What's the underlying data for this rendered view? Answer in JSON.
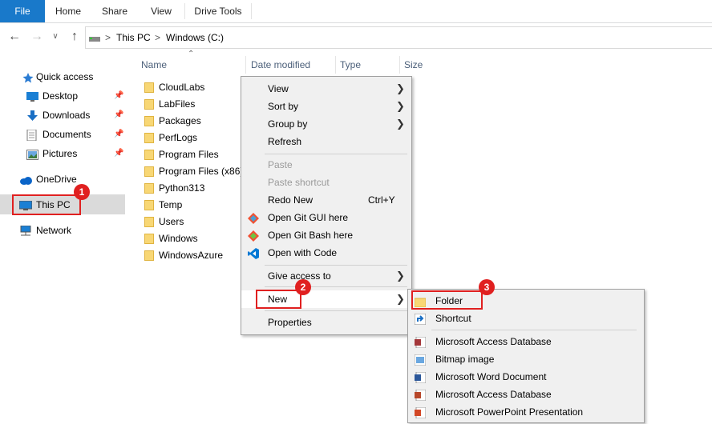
{
  "ribbon": {
    "tabs": [
      "File",
      "Home",
      "Share",
      "View",
      "Drive Tools"
    ]
  },
  "address": {
    "crumbs": [
      "This PC",
      "Windows (C:)"
    ],
    "separator": ">"
  },
  "nav": {
    "quick_access": "Quick access",
    "items": [
      "Desktop",
      "Downloads",
      "Documents",
      "Pictures"
    ],
    "onedrive": "OneDrive",
    "thispc": "This PC",
    "network": "Network"
  },
  "columns": [
    "Name",
    "Date modified",
    "Type",
    "Size"
  ],
  "files": [
    "CloudLabs",
    "LabFiles",
    "Packages",
    "PerfLogs",
    "Program Files",
    "Program Files (x86)",
    "Python313",
    "Temp",
    "Users",
    "Windows",
    "WindowsAzure"
  ],
  "context_menu": {
    "view": "View",
    "sort_by": "Sort by",
    "group_by": "Group by",
    "refresh": "Refresh",
    "paste": "Paste",
    "paste_shortcut": "Paste shortcut",
    "redo": "Redo New",
    "redo_shortcut": "Ctrl+Y",
    "git_gui": "Open Git GUI here",
    "git_bash": "Open Git Bash here",
    "open_code": "Open with Code",
    "give_access": "Give access to",
    "new": "New",
    "properties": "Properties"
  },
  "submenu": {
    "folder": "Folder",
    "shortcut": "Shortcut",
    "access1": "Microsoft Access Database",
    "bitmap": "Bitmap image",
    "word": "Microsoft Word Document",
    "access2": "Microsoft Access Database",
    "powerpoint": "Microsoft PowerPoint Presentation"
  },
  "badges": [
    "1",
    "2",
    "3"
  ],
  "colors": {
    "file_tab": "#1979ca",
    "highlight": "#e02020",
    "folder": "#f8d775"
  }
}
